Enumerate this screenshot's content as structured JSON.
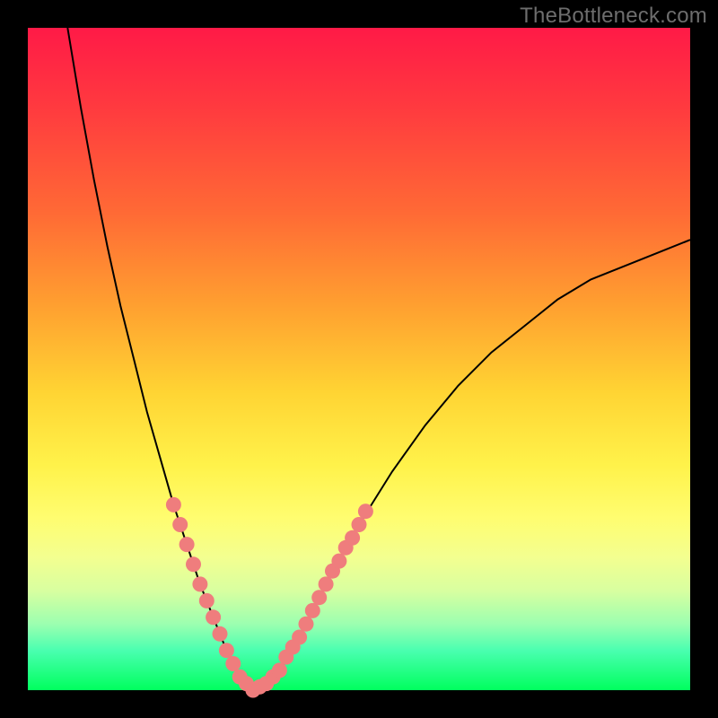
{
  "watermark": "TheBottleneck.com",
  "colors": {
    "frame": "#000000",
    "gradient_top": "#ff1a47",
    "gradient_mid": "#fff24a",
    "gradient_bottom": "#00ff5e",
    "curve": "#000000",
    "dots": "#ef7d7d"
  },
  "chart_data": {
    "type": "line",
    "title": "",
    "xlabel": "",
    "ylabel": "",
    "xlim": [
      0,
      100
    ],
    "ylim": [
      0,
      100
    ],
    "grid": false,
    "legend": false,
    "series": [
      {
        "name": "bottleneck-curve",
        "description": "V-shaped curve with minimum ~0 near x≈34; left arm steep toward 100 at x≈6, right arm rises toward ~68 at x≈100",
        "x": [
          6,
          8,
          10,
          12,
          14,
          16,
          18,
          20,
          22,
          24,
          26,
          28,
          30,
          32,
          34,
          36,
          38,
          40,
          42,
          45,
          50,
          55,
          60,
          65,
          70,
          75,
          80,
          85,
          90,
          95,
          100
        ],
        "y": [
          100,
          88,
          77,
          67,
          58,
          50,
          42,
          35,
          28,
          22,
          16,
          11,
          6,
          2,
          0,
          1,
          3,
          6,
          10,
          16,
          25,
          33,
          40,
          46,
          51,
          55,
          59,
          62,
          64,
          66,
          68
        ]
      }
    ],
    "points": [
      {
        "name": "left-arm-dot",
        "x": 22,
        "y": 28
      },
      {
        "name": "left-arm-dot",
        "x": 23,
        "y": 25
      },
      {
        "name": "left-arm-dot",
        "x": 24,
        "y": 22
      },
      {
        "name": "left-arm-dot",
        "x": 25,
        "y": 19
      },
      {
        "name": "left-arm-dot",
        "x": 26,
        "y": 16
      },
      {
        "name": "left-arm-dot",
        "x": 27,
        "y": 13.5
      },
      {
        "name": "left-arm-dot",
        "x": 28,
        "y": 11
      },
      {
        "name": "left-arm-dot",
        "x": 29,
        "y": 8.5
      },
      {
        "name": "left-arm-dot",
        "x": 30,
        "y": 6
      },
      {
        "name": "bottom-dot",
        "x": 31,
        "y": 4
      },
      {
        "name": "bottom-dot",
        "x": 32,
        "y": 2
      },
      {
        "name": "bottom-dot",
        "x": 33,
        "y": 1
      },
      {
        "name": "bottom-dot",
        "x": 34,
        "y": 0
      },
      {
        "name": "bottom-dot",
        "x": 35,
        "y": 0.5
      },
      {
        "name": "bottom-dot",
        "x": 36,
        "y": 1
      },
      {
        "name": "bottom-dot",
        "x": 37,
        "y": 2
      },
      {
        "name": "right-arm-dot",
        "x": 38,
        "y": 3
      },
      {
        "name": "right-arm-dot",
        "x": 39,
        "y": 5
      },
      {
        "name": "right-arm-dot",
        "x": 40,
        "y": 6.5
      },
      {
        "name": "right-arm-dot",
        "x": 41,
        "y": 8
      },
      {
        "name": "right-arm-dot",
        "x": 42,
        "y": 10
      },
      {
        "name": "right-arm-dot",
        "x": 43,
        "y": 12
      },
      {
        "name": "right-arm-dot",
        "x": 44,
        "y": 14
      },
      {
        "name": "right-arm-dot",
        "x": 45,
        "y": 16
      },
      {
        "name": "right-arm-dot",
        "x": 46,
        "y": 18
      },
      {
        "name": "right-arm-dot",
        "x": 47,
        "y": 19.5
      },
      {
        "name": "right-arm-dot",
        "x": 48,
        "y": 21.5
      },
      {
        "name": "right-arm-dot",
        "x": 49,
        "y": 23
      },
      {
        "name": "right-arm-dot",
        "x": 50,
        "y": 25
      },
      {
        "name": "right-arm-dot",
        "x": 51,
        "y": 27
      }
    ]
  }
}
